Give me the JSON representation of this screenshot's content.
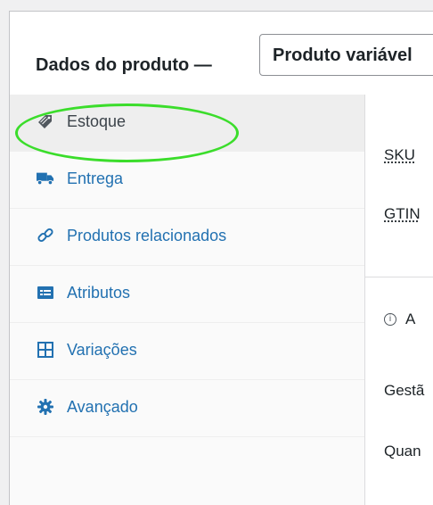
{
  "header": {
    "title": "Dados do produto —",
    "product_type_value": "Produto variável"
  },
  "tabs": [
    {
      "label": "Estoque",
      "icon": "inventory-tag-icon",
      "active": true
    },
    {
      "label": "Entrega",
      "icon": "truck-icon",
      "active": false
    },
    {
      "label": "Produtos relacionados",
      "icon": "link-icon",
      "active": false
    },
    {
      "label": "Atributos",
      "icon": "attributes-list-icon",
      "active": false
    },
    {
      "label": "Variações",
      "icon": "grid-icon",
      "active": false
    },
    {
      "label": "Avançado",
      "icon": "gear-icon",
      "active": false
    }
  ],
  "content": {
    "sku_label": "SKU",
    "gtin_label": "GTIN",
    "info_text": "A",
    "stock_management_label": "Gestã",
    "quantity_label": "Quan"
  },
  "colors": {
    "link": "#2271b1",
    "active_text": "#3c434a",
    "highlight": "#3bdd2b"
  }
}
